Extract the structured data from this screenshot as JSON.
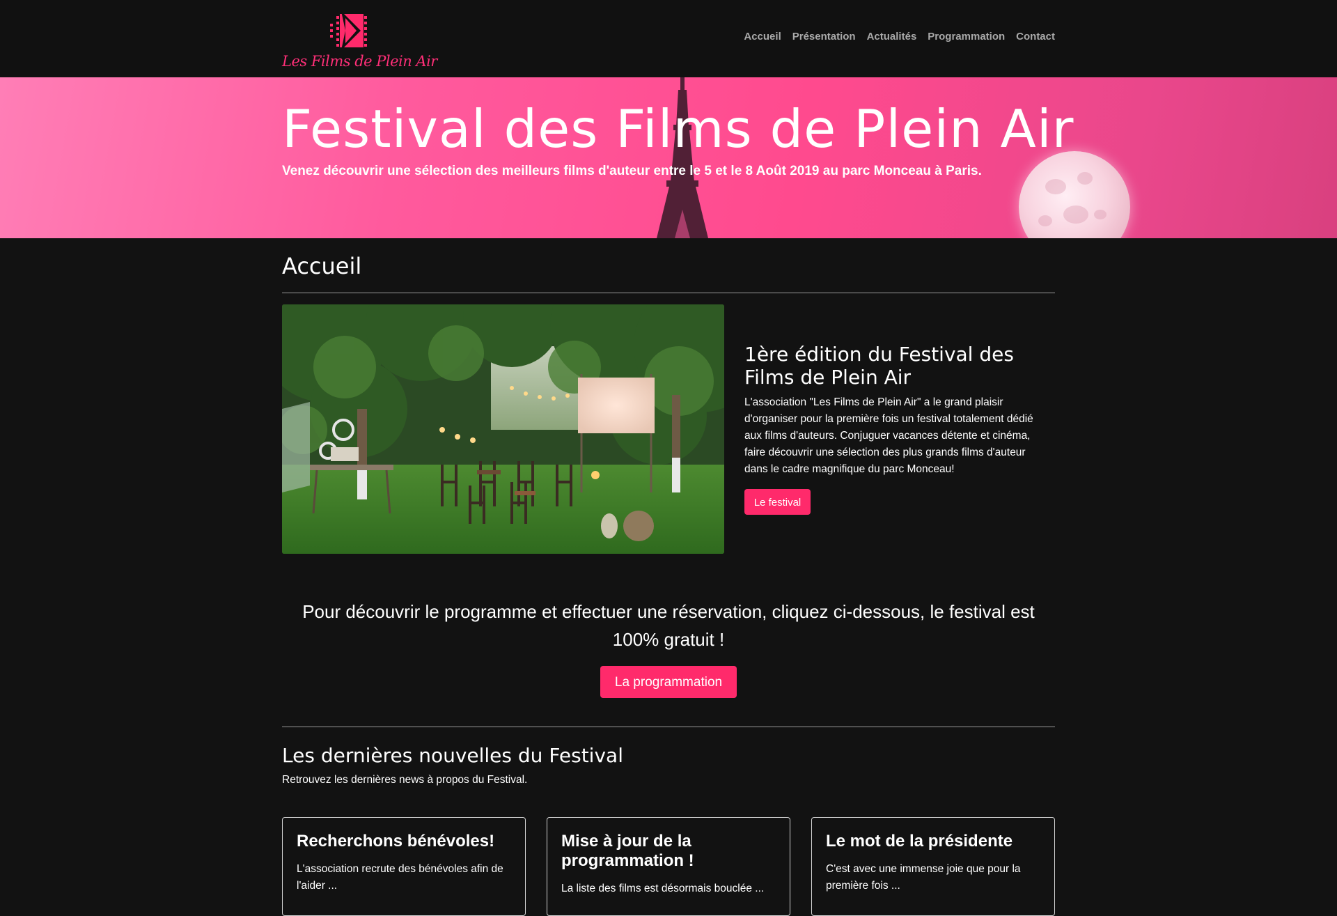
{
  "brand": {
    "name": "Les Films de Plein Air",
    "logo_icon": "film-strip-play-icon",
    "accent_color": "#ff2a6b"
  },
  "nav": {
    "items": [
      {
        "label": "Accueil"
      },
      {
        "label": "Présentation"
      },
      {
        "label": "Actualités"
      },
      {
        "label": "Programmation"
      },
      {
        "label": "Contact"
      }
    ]
  },
  "hero": {
    "title": "Festival des Films de Plein Air",
    "subtitle": "Venez découvrir une sélection des meilleurs films d'auteur entre le 5 et le 8 Août 2019 au parc Monceau à Paris."
  },
  "main": {
    "page_title": "Accueil",
    "feature": {
      "title": "1ère édition du Festival des Films de Plein Air",
      "text": "L'association \"Les Films de Plein Air\" a le grand plaisir d'organiser pour la première fois un festival totalement dédié aux films d'auteurs. Conjuguer vacances détente et cinéma, faire découvrir une sélection des plus grands films d'auteur dans le cadre magnifique du parc Monceau!",
      "button_label": "Le festival"
    },
    "cta": {
      "text": "Pour découvrir le programme et effectuer une réservation, cliquez ci-dessous, le festival est 100% gratuit !",
      "button_label": "La programmation"
    }
  },
  "news": {
    "title": "Les dernières nouvelles du Festival",
    "subtitle": "Retrouvez les dernières news à propos du Festival.",
    "cards": [
      {
        "title": "Recherchons bénévoles!",
        "text": "L'association recrute des bénévoles afin de l'aider ..."
      },
      {
        "title": "Mise à jour de la programmation !",
        "text": "La liste des films est désormais bouclée ..."
      },
      {
        "title": "Le mot de la présidente",
        "text": "C'est avec une immense joie que pour la première fois ..."
      }
    ]
  }
}
